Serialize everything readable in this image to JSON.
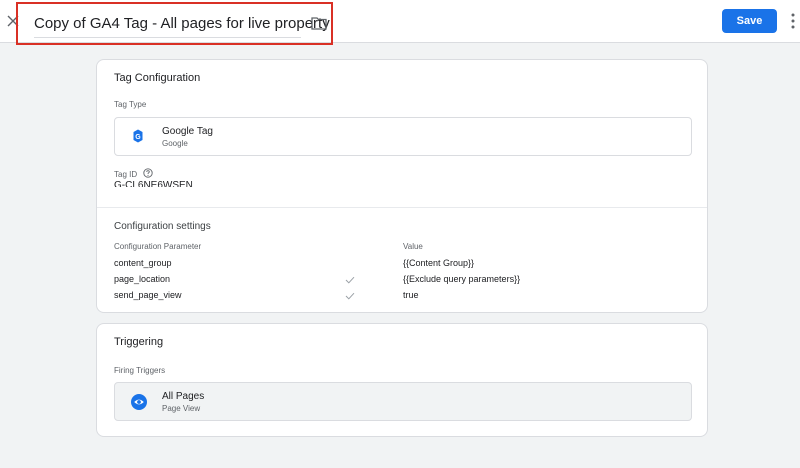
{
  "header": {
    "title": "Copy of GA4 Tag - All pages for live property",
    "save_label": "Save"
  },
  "tag_config": {
    "heading": "Tag Configuration",
    "tag_type_label": "Tag Type",
    "tag_type": {
      "name": "Google Tag",
      "vendor": "Google",
      "icon": "google-tag-icon",
      "icon_letter": "G"
    },
    "tag_id_label": "Tag ID",
    "tag_id_value": "G-CL6NE6WSEN",
    "settings_heading": "Configuration settings",
    "param_col": "Configuration Parameter",
    "value_col": "Value",
    "rows": [
      {
        "param": "content_group",
        "value": "{{Content Group}}",
        "checked": false
      },
      {
        "param": "page_location",
        "value": "{{Exclude query parameters}}",
        "checked": true
      },
      {
        "param": "send_page_view",
        "value": "true",
        "checked": true
      }
    ]
  },
  "triggering": {
    "heading": "Triggering",
    "firing_label": "Firing Triggers",
    "trigger": {
      "name": "All Pages",
      "type": "Page View",
      "icon": "eye-icon"
    }
  },
  "colors": {
    "accent": "#1a73e8",
    "highlight": "#d93025"
  }
}
